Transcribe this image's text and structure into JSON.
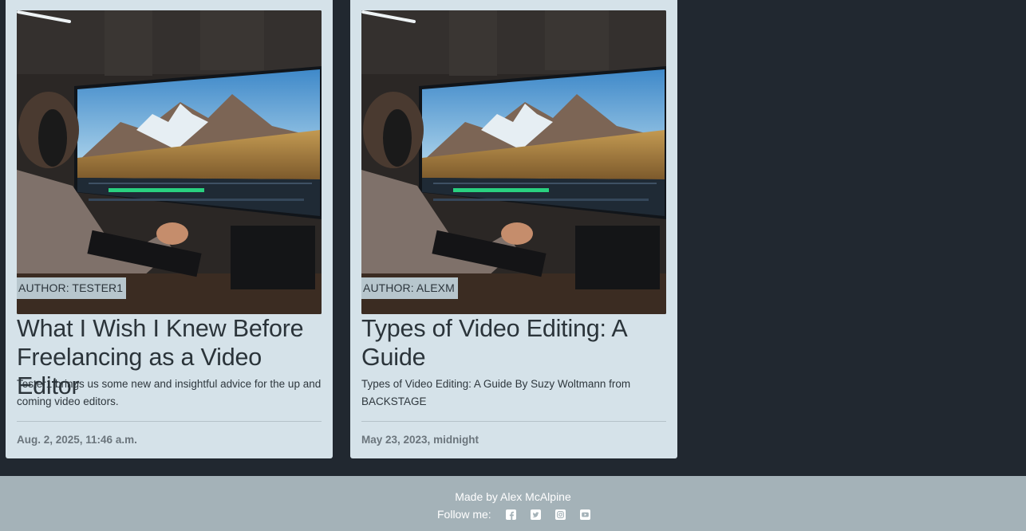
{
  "posts": [
    {
      "author": "AUTHOR: TESTER1",
      "title": "What I Wish I Knew Before Freelancing as a Video Editor",
      "excerpt": "Tester1 brings us some new and insightful advice for the up and coming video editors.",
      "date": "Aug. 2, 2025, 11:46 a.m."
    },
    {
      "author": "AUTHOR: ALEXM",
      "title": "Types of Video Editing: A Guide",
      "excerpt": "Types of Video Editing: A Guide By Suzy Woltmann from BACKSTAGE",
      "date": "May 23, 2023, midnight"
    }
  ],
  "footer": {
    "credit": "Made by Alex McAlpine",
    "follow_label": "Follow me:",
    "social_icons": [
      "facebook-icon",
      "twitter-icon",
      "instagram-icon",
      "youtube-icon"
    ]
  },
  "colors": {
    "page_bg": "#212830",
    "card_bg": "#d5e2e9",
    "footer_bg": "#a4b2b8",
    "badge_bg": "#b7c6cd"
  }
}
